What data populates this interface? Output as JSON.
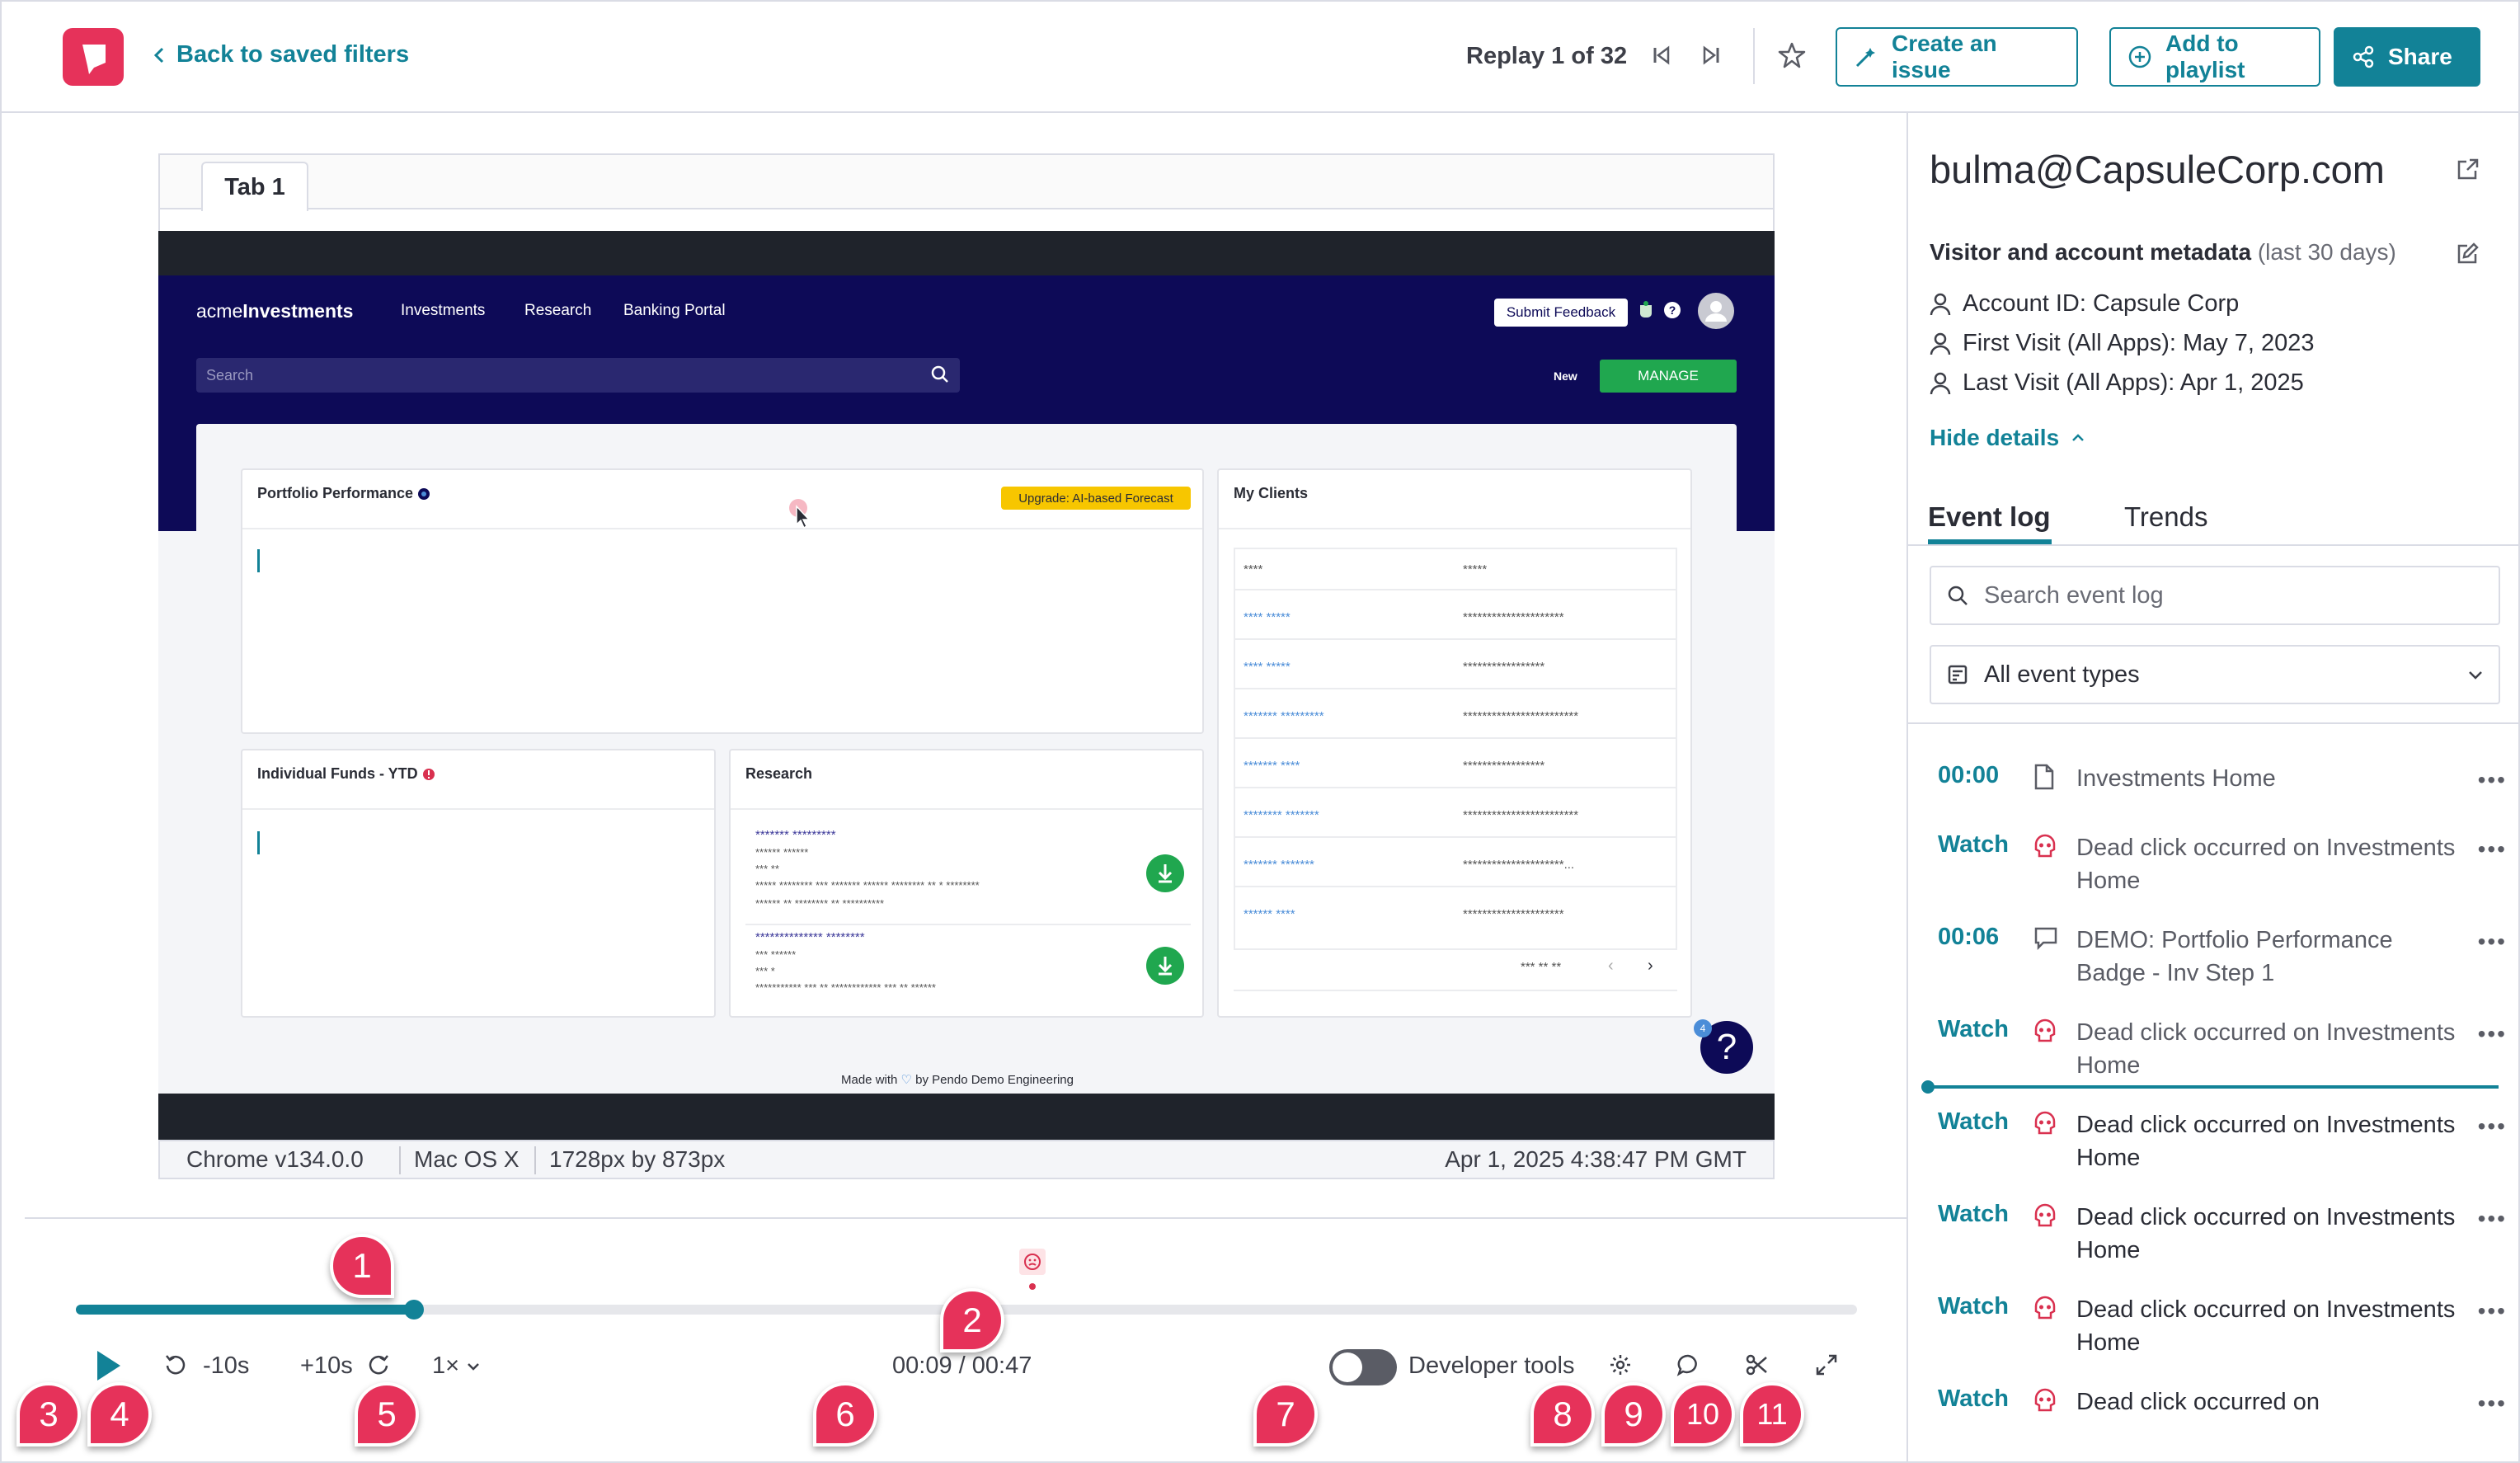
{
  "header": {
    "back_label": "Back to saved filters",
    "replay_prefix": "Replay",
    "replay_current": "1",
    "replay_of": "of",
    "replay_total": "32",
    "create_issue": "Create an issue",
    "add_playlist": "Add to playlist",
    "share": "Share"
  },
  "session": {
    "tab_label": "Tab 1",
    "browser": "Chrome v134.0.0",
    "os": "Mac OS X",
    "resolution": "1728px by 873px",
    "timestamp": "Apr 1, 2025 4:38:47 PM GMT"
  },
  "app": {
    "brand_light": "acme",
    "brand_bold": "Investments",
    "nav": [
      "Investments",
      "Research",
      "Banking Portal"
    ],
    "feedback": "Submit Feedback",
    "search_placeholder": "Search",
    "new_label": "New",
    "manage": "MANAGE",
    "portfolio_title": "Portfolio Performance",
    "upgrade_badge": "Upgrade: AI-based Forecast",
    "clients_title": "My Clients",
    "funds_title": "Individual Funds - YTD",
    "research_title": "Research",
    "clients_header": [
      "****",
      "*****"
    ],
    "clients_rows": [
      [
        "**** *****",
        "*********************"
      ],
      [
        "**** *****",
        "*****************"
      ],
      [
        "******* *********",
        "************************"
      ],
      [
        "******* ****",
        "*****************"
      ],
      [
        "******** *******",
        "************************"
      ],
      [
        "******* *******",
        "*********************..."
      ],
      [
        "****** ****",
        "*********************"
      ]
    ],
    "clients_footer": "*** ** **",
    "research_items": [
      {
        "title": "******* *********",
        "lines": [
          "****** ******",
          "*** **",
          "***** ******** *** ******* ****** ******** ** * ********",
          "****** ** ******** ** **********"
        ]
      },
      {
        "title": "************** ********",
        "lines": [
          "*** ******",
          "*** *",
          "*********** *** ** ************ *** ** ******"
        ]
      }
    ],
    "made_with_prefix": "Made with",
    "made_with_suffix": "by Pendo Demo Engineering",
    "help_badge": "4",
    "help_glyph": "?"
  },
  "player": {
    "back10": "-10s",
    "fwd10": "+10s",
    "speed": "1×",
    "time_current": "00:09",
    "time_total": "00:47",
    "time_sep": "/",
    "devtools_label": "Developer tools",
    "devtools_on": false,
    "progress_fraction": 0.19
  },
  "annotations": [
    "1",
    "2",
    "3",
    "4",
    "5",
    "6",
    "7",
    "8",
    "9",
    "10",
    "11"
  ],
  "sidebar": {
    "email": "bulma@CapsuleCorp.com",
    "meta_title": "Visitor and account metadata",
    "meta_sub": "(last 30 days)",
    "meta": [
      "Account ID: Capsule Corp",
      "First Visit (All Apps): May 7, 2023",
      "Last Visit (All Apps): Apr 1, 2025"
    ],
    "hide_details": "Hide details",
    "tabs": [
      "Event log",
      "Trends"
    ],
    "search_placeholder": "Search event log",
    "event_filter": "All event types",
    "events": [
      {
        "time": "00:00",
        "icon": "page-icon",
        "text": "Investments Home"
      },
      {
        "time": "Watch",
        "icon": "skull-icon",
        "text": "Dead click occurred on Investments Home"
      },
      {
        "time": "00:06",
        "icon": "guide-icon",
        "text": "DEMO: Portfolio Performance Badge - Inv Step 1"
      },
      {
        "time": "Watch",
        "icon": "skull-icon",
        "text": "Dead click occurred on Investments Home"
      },
      {
        "time": "Watch",
        "icon": "skull-icon",
        "text": "Dead click occurred on Investments Home"
      },
      {
        "time": "Watch",
        "icon": "skull-icon",
        "text": "Dead click occurred on Investments Home"
      },
      {
        "time": "Watch",
        "icon": "skull-icon",
        "text": "Dead click occurred on Investments Home"
      },
      {
        "time": "Watch",
        "icon": "skull-icon",
        "text": "Dead click occurred on"
      }
    ],
    "more_glyph": "•••"
  },
  "colors": {
    "brand": "#e6325a",
    "accent": "#128297",
    "app_nav": "#0d0a57",
    "success": "#20a74f",
    "badge": "#f7c600"
  }
}
